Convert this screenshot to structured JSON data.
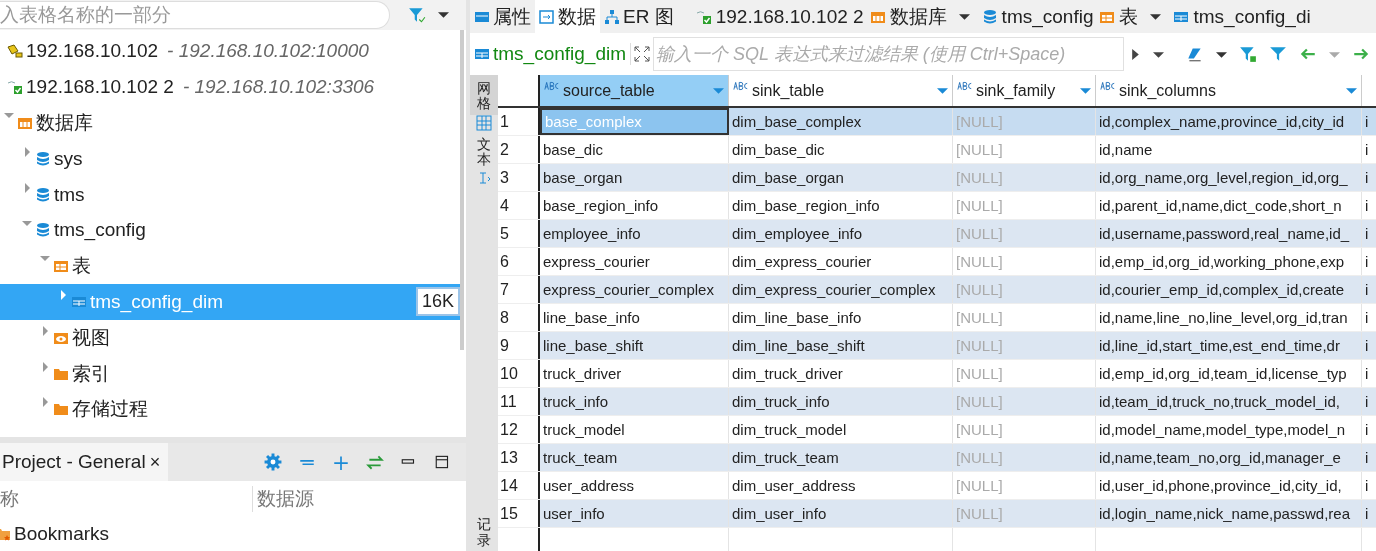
{
  "navigator": {
    "search_placeholder": "入表格名称的一部分",
    "tree": [
      {
        "label": "192.168.10.102",
        "detail": "- 192.168.10.102:10000",
        "kind": "server",
        "selected": false
      },
      {
        "label": "192.168.10.102 2",
        "detail": "- 192.168.10.102:3306",
        "kind": "connection",
        "selected": false
      },
      {
        "label": "数据库",
        "kind": "folder-db",
        "expanded": true,
        "selected": false,
        "children": [
          {
            "label": "sys",
            "kind": "database",
            "expanded": false,
            "selected": false
          },
          {
            "label": "tms",
            "kind": "database",
            "expanded": false,
            "selected": false
          },
          {
            "label": "tms_config",
            "kind": "database",
            "expanded": true,
            "selected": false,
            "children": [
              {
                "label": "表",
                "kind": "folder-table",
                "expanded": true,
                "selected": false,
                "children": [
                  {
                    "label": "tms_config_dim",
                    "kind": "table",
                    "expanded": false,
                    "selected": true,
                    "badge": "16K"
                  }
                ]
              },
              {
                "label": "视图",
                "kind": "folder-view",
                "expanded": false,
                "selected": false
              },
              {
                "label": "索引",
                "kind": "folder",
                "expanded": false,
                "selected": false
              },
              {
                "label": "存储过程",
                "kind": "folder",
                "expanded": false,
                "selected": false
              }
            ]
          }
        ]
      }
    ]
  },
  "project_panel": {
    "title": "Project - General",
    "close": "×",
    "columns": [
      "称",
      "数据源"
    ],
    "items": [
      {
        "label": "Bookmarks"
      }
    ]
  },
  "editor": {
    "tabs": [
      {
        "label": "属性",
        "kind": "properties",
        "selected": false
      },
      {
        "label": "数据",
        "kind": "data",
        "selected": true
      },
      {
        "label": "ER 图",
        "kind": "er",
        "selected": false
      }
    ],
    "breadcrumb": [
      {
        "label": "192.168.10.102 2",
        "kind": "connection"
      },
      {
        "label": "数据库",
        "kind": "folder-db"
      },
      {
        "label": "tms_config",
        "kind": "database"
      },
      {
        "label": "表",
        "kind": "folder-table"
      },
      {
        "label": "tms_config_di",
        "kind": "table"
      }
    ],
    "filter": {
      "entity": "tms_config_dim",
      "placeholder": "输入一个 SQL 表达式来过滤结果 (使用 Ctrl+Space)"
    },
    "side_tabs": [
      {
        "label": "网格",
        "selected": true
      },
      {
        "label": "文本",
        "selected": false
      },
      {
        "label": "记录",
        "selected": false
      }
    ],
    "table": {
      "columns": [
        {
          "label": "source_table",
          "selected": true,
          "dimmed": false
        },
        {
          "label": "sink_table",
          "selected": false,
          "dimmed": false
        },
        {
          "label": "sink_family",
          "selected": false,
          "dimmed": true
        },
        {
          "label": "sink_columns",
          "selected": false,
          "dimmed": false
        }
      ],
      "rows": [
        {
          "number": "1",
          "selected": true,
          "cells": [
            "base_complex",
            "dim_base_complex",
            "[NULL]",
            "id,complex_name,province_id,city_id",
            "i"
          ]
        },
        {
          "number": "2",
          "selected": false,
          "cells": [
            "base_dic",
            "dim_base_dic",
            "[NULL]",
            "id,name",
            "i"
          ]
        },
        {
          "number": "3",
          "selected": false,
          "cells": [
            "base_organ",
            "dim_base_organ",
            "[NULL]",
            "id,org_name,org_level,region_id,org_",
            "i"
          ]
        },
        {
          "number": "4",
          "selected": false,
          "cells": [
            "base_region_info",
            "dim_base_region_info",
            "[NULL]",
            "id,parent_id,name,dict_code,short_n",
            "i"
          ]
        },
        {
          "number": "5",
          "selected": false,
          "cells": [
            "employee_info",
            "dim_employee_info",
            "[NULL]",
            "id,username,password,real_name,id_",
            "i"
          ]
        },
        {
          "number": "6",
          "selected": false,
          "cells": [
            "express_courier",
            "dim_express_courier",
            "[NULL]",
            "id,emp_id,org_id,working_phone,exp",
            "i"
          ]
        },
        {
          "number": "7",
          "selected": false,
          "cells": [
            "express_courier_complex",
            "dim_express_courier_complex",
            "[NULL]",
            "id,courier_emp_id,complex_id,create",
            "i"
          ]
        },
        {
          "number": "8",
          "selected": false,
          "cells": [
            "line_base_info",
            "dim_line_base_info",
            "[NULL]",
            "id,name,line_no,line_level,org_id,tran",
            "i"
          ]
        },
        {
          "number": "9",
          "selected": false,
          "cells": [
            "line_base_shift",
            "dim_line_base_shift",
            "[NULL]",
            "id,line_id,start_time,est_end_time,dr",
            "i"
          ]
        },
        {
          "number": "10",
          "selected": false,
          "cells": [
            "truck_driver",
            "dim_truck_driver",
            "[NULL]",
            "id,emp_id,org_id,team_id,license_typ",
            "i"
          ]
        },
        {
          "number": "11",
          "selected": false,
          "cells": [
            "truck_info",
            "dim_truck_info",
            "[NULL]",
            "id,team_id,truck_no,truck_model_id,",
            "i"
          ]
        },
        {
          "number": "12",
          "selected": false,
          "cells": [
            "truck_model",
            "dim_truck_model",
            "[NULL]",
            "id,model_name,model_type,model_n",
            "i"
          ]
        },
        {
          "number": "13",
          "selected": false,
          "cells": [
            "truck_team",
            "dim_truck_team",
            "[NULL]",
            "id,name,team_no,org_id,manager_e",
            "i"
          ]
        },
        {
          "number": "14",
          "selected": false,
          "cells": [
            "user_address",
            "dim_user_address",
            "[NULL]",
            "id,user_id,phone,province_id,city_id,",
            "i"
          ]
        },
        {
          "number": "15",
          "selected": false,
          "cells": [
            "user_info",
            "dim_user_info",
            "[NULL]",
            "id,login_name,nick_name,passwd,rea",
            "i"
          ]
        }
      ]
    }
  }
}
